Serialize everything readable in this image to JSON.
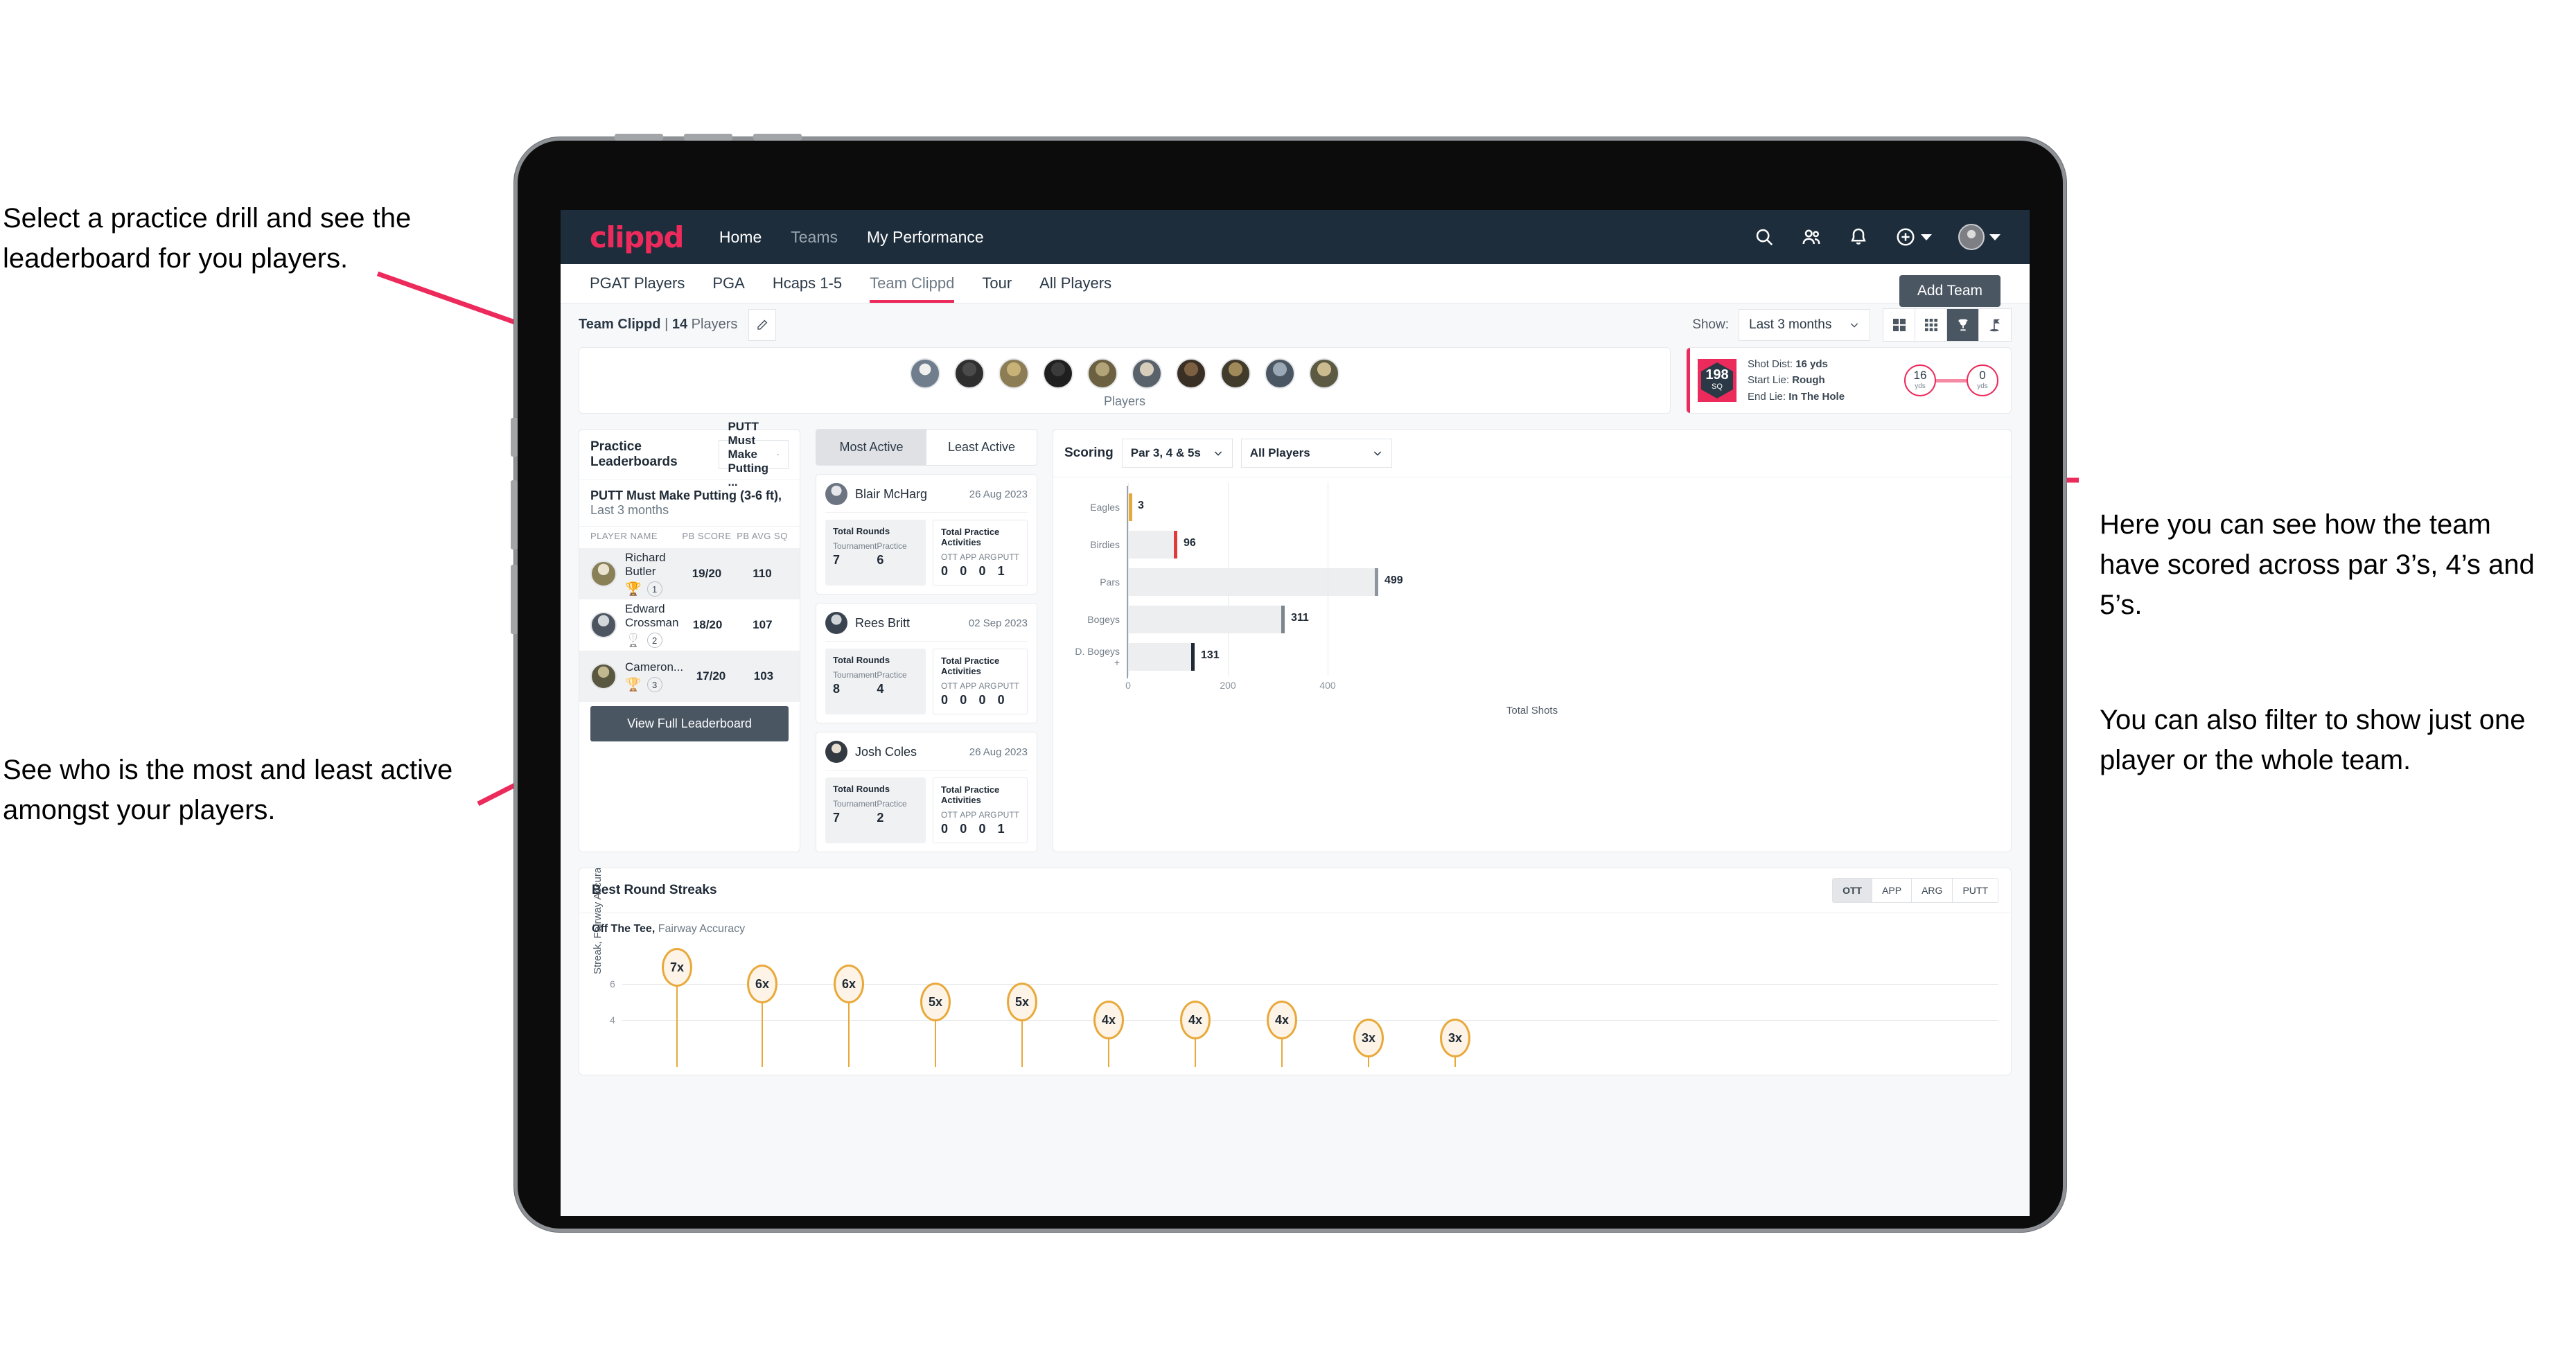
{
  "annotations": [
    {
      "id": "a1",
      "text": "Select a practice drill and see the leaderboard for you players."
    },
    {
      "id": "a2",
      "text": "See who is the most and least active amongst your players."
    },
    {
      "id": "a3",
      "text": "Here you can see how the team have scored across par 3’s, 4’s and 5’s."
    },
    {
      "id": "a4",
      "text": "You can also filter to show just one player or the whole team."
    }
  ],
  "colors": {
    "brand": "#ec2a5b",
    "navbar": "#1e2d3b",
    "button_dark": "#4b5663",
    "accent_amber": "#e9a93a",
    "page_bg": "#f7f8fa"
  },
  "topnav": {
    "logo": "clippd",
    "links": [
      {
        "label": "Home",
        "active": true
      },
      {
        "label": "Teams",
        "active": false
      },
      {
        "label": "My Performance",
        "active": true
      }
    ],
    "icons": [
      "search-icon",
      "people-icon",
      "bell-icon",
      "plus-circle-icon",
      "avatar"
    ]
  },
  "tabbar": {
    "tabs": [
      {
        "label": "PGAT Players",
        "active": false
      },
      {
        "label": "PGA",
        "active": false
      },
      {
        "label": "Hcaps 1-5",
        "active": false
      },
      {
        "label": "Team Clippd",
        "active": true
      },
      {
        "label": "Tour",
        "active": false
      },
      {
        "label": "All Players",
        "active": false
      }
    ],
    "add_team_label": "Add Team"
  },
  "toolbar": {
    "team_name": "Team Clippd",
    "team_divider": "|",
    "player_count": "14",
    "players_word": "Players",
    "edit_icon": "pencil-icon",
    "show_label": "Show:",
    "range_value": "Last 3 months",
    "view_modes": [
      {
        "name": "grid-2x2-icon",
        "active": false
      },
      {
        "name": "grid-3x3-icon",
        "active": false
      },
      {
        "name": "trophy-icon",
        "active": true
      },
      {
        "name": "golf-flag-icon",
        "active": false
      }
    ]
  },
  "players_card": {
    "caption": "Players",
    "avatar_count": 10
  },
  "shot_card": {
    "badge_value": "198",
    "badge_unit": "SQ",
    "lines": [
      {
        "label": "Shot Dist:",
        "value": "16 yds"
      },
      {
        "label": "Start Lie:",
        "value": "Rough"
      },
      {
        "label": "End Lie:",
        "value": "In The Hole"
      }
    ],
    "start_yds": "16",
    "end_yds": "0",
    "yds_unit": "yds"
  },
  "leaderboard": {
    "title": "Practice Leaderboards",
    "drill_select": "PUTT Must Make Putting ...",
    "subtitle_bold": "PUTT Must Make Putting (3-6 ft),",
    "subtitle_muted": "Last 3 months",
    "columns": [
      "PLAYER NAME",
      "PB SCORE",
      "PB AVG SQ"
    ],
    "rows": [
      {
        "name": "Richard Butler",
        "rank": "1",
        "trophy": "gold",
        "score": "19/20",
        "avg": "110"
      },
      {
        "name": "Edward Crossman",
        "rank": "2",
        "trophy": "silver",
        "score": "18/20",
        "avg": "107"
      },
      {
        "name": "Cameron...",
        "rank": "3",
        "trophy": "bronze",
        "score": "17/20",
        "avg": "103"
      }
    ],
    "button_label": "View Full Leaderboard"
  },
  "activity": {
    "tabs": [
      {
        "label": "Most Active",
        "active": true
      },
      {
        "label": "Least Active",
        "active": false
      }
    ],
    "rounds_title": "Total Rounds",
    "practice_title": "Total Practice Activities",
    "rounds_keys": [
      "Tournament",
      "Practice"
    ],
    "practice_keys": [
      "OTT",
      "APP",
      "ARG",
      "PUTT"
    ],
    "items": [
      {
        "name": "Blair McHarg",
        "date": "26 Aug 2023",
        "tournament": "7",
        "practice": "6",
        "ott": "0",
        "app": "0",
        "arg": "0",
        "putt": "1"
      },
      {
        "name": "Rees Britt",
        "date": "02 Sep 2023",
        "tournament": "8",
        "practice": "4",
        "ott": "0",
        "app": "0",
        "arg": "0",
        "putt": "0"
      },
      {
        "name": "Josh Coles",
        "date": "26 Aug 2023",
        "tournament": "7",
        "practice": "2",
        "ott": "0",
        "app": "0",
        "arg": "0",
        "putt": "1"
      }
    ]
  },
  "scoring": {
    "title": "Scoring",
    "par_select": "Par 3, 4 & 5s",
    "players_select": "All Players"
  },
  "streaks": {
    "title": "Best Round Streaks",
    "toggles": [
      {
        "label": "OTT",
        "active": true
      },
      {
        "label": "APP",
        "active": false
      },
      {
        "label": "ARG",
        "active": false
      },
      {
        "label": "PUTT",
        "active": false
      }
    ],
    "sub_bold": "Off The Tee,",
    "sub_muted": "Fairway Accuracy"
  },
  "chart_data": [
    {
      "type": "bar",
      "orientation": "horizontal",
      "title": "Scoring",
      "categories": [
        "Eagles",
        "Birdies",
        "Pars",
        "Bogeys",
        "D. Bogeys +"
      ],
      "values": [
        3,
        96,
        499,
        311,
        131
      ],
      "cap_colors": [
        "#e9a93a",
        "#e03a3a",
        "#8d959d",
        "#7d858d",
        "#1f2a36"
      ],
      "xlabel": "Total Shots",
      "ylabel": "",
      "xlim": [
        0,
        520
      ],
      "xticks": [
        0,
        200,
        400
      ],
      "grid": true,
      "legend": "none"
    },
    {
      "type": "scatter",
      "subtype": "lollipop",
      "title": "Best Round Streaks",
      "series_name": "Off The Tee, Fairway Accuracy",
      "ylabel": "Streak, Fairway Accuracy",
      "yticks": [
        4,
        6
      ],
      "ylim": [
        0,
        8
      ],
      "labels": [
        "7x",
        "6x",
        "6x",
        "5x",
        "5x",
        "4x",
        "4x",
        "4x",
        "3x",
        "3x"
      ],
      "values": [
        7,
        6,
        6,
        5,
        5,
        4,
        4,
        4,
        3,
        3
      ],
      "grid": true,
      "legend": "none"
    }
  ]
}
